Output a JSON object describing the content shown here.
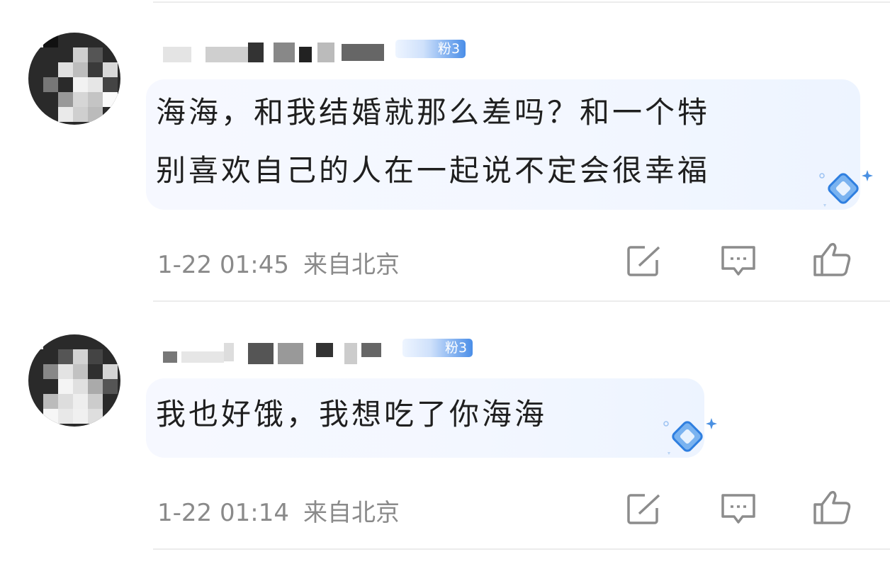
{
  "comments": [
    {
      "text_line1": "海海，和我结婚就那么差吗？和一个特",
      "text_line2": "别喜欢自己的人在一起说不定会很幸福",
      "time": "1-22 01:45",
      "location": "来自北京",
      "fan_badge": "粉3"
    },
    {
      "text_line1": "我也好饿，我想吃了你海海",
      "time": "1-22 01:14",
      "location": "来自北京",
      "fan_badge": "粉3"
    }
  ],
  "icons": {
    "repost": "repost-icon",
    "comment": "comment-icon",
    "like": "like-icon",
    "gem": "diamond-gem-icon"
  },
  "colors": {
    "bubble": "#f3f7ff",
    "badge": "#4a8ee8",
    "meta": "#8a8a8a"
  }
}
